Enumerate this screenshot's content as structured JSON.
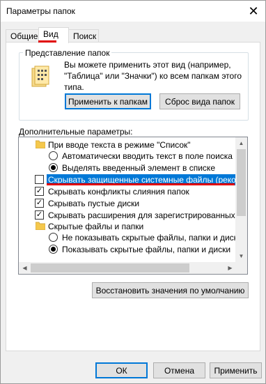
{
  "window": {
    "title": "Параметры папок",
    "close_glyph": "✕"
  },
  "tabs": [
    {
      "label": "Общие",
      "active": false
    },
    {
      "label": "Вид",
      "active": true
    },
    {
      "label": "Поиск",
      "active": false
    }
  ],
  "folder_views": {
    "group_label": "Представление папок",
    "description": "Вы можете применить этот вид (например, \"Таблица\" или \"Значки\") ко всем папкам этого типа.",
    "apply_button": "Применить к папкам",
    "reset_button": "Сброс вида папок"
  },
  "advanced": {
    "label": "Дополнительные параметры:",
    "items": [
      {
        "kind": "folder",
        "text": "При вводе текста в режиме \"Список\""
      },
      {
        "kind": "radio",
        "checked": false,
        "text": "Автоматически вводить текст в поле поиска"
      },
      {
        "kind": "radio",
        "checked": true,
        "text": "Выделять введенный элемент в списке"
      },
      {
        "kind": "checkbox",
        "checked": false,
        "selected": true,
        "text": "Скрывать защищенные системные файлы (рекомен"
      },
      {
        "kind": "checkbox",
        "checked": true,
        "text": "Скрывать конфликты слияния папок"
      },
      {
        "kind": "checkbox",
        "checked": true,
        "text": "Скрывать пустые диски"
      },
      {
        "kind": "checkbox",
        "checked": true,
        "text": "Скрывать расширения для зарегистрированных типо"
      },
      {
        "kind": "folder",
        "text": "Скрытые файлы и папки"
      },
      {
        "kind": "radio",
        "checked": false,
        "text": "Не показывать скрытые файлы, папки и диски"
      },
      {
        "kind": "radio",
        "checked": true,
        "text": "Показывать скрытые файлы, папки и диски"
      }
    ],
    "restore_button": "Восстановить значения по умолчанию"
  },
  "footer": {
    "ok": "ОК",
    "cancel": "Отмена",
    "apply": "Применить"
  },
  "colors": {
    "selection": "#0078d7",
    "annotation": "#e00000",
    "checkmark": "✓"
  }
}
